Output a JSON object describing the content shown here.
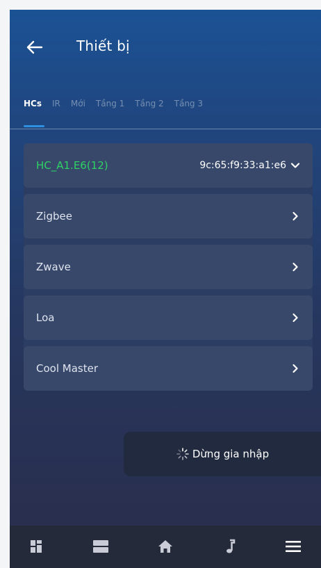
{
  "header": {
    "title": "Thiết bị",
    "back_icon": "arrow-left-icon"
  },
  "tabs": [
    {
      "label": "HCs",
      "active": true
    },
    {
      "label": "IR",
      "active": false
    },
    {
      "label": "Mới",
      "active": false
    },
    {
      "label": "Tầng 1",
      "active": false
    },
    {
      "label": "Tầng 2",
      "active": false
    },
    {
      "label": "Tầng 3",
      "active": false
    }
  ],
  "hc": {
    "name": "HC_A1.E6(12)",
    "mac": "9c:65:f9:33:a1:e6",
    "name_color": "#2fd264"
  },
  "items": [
    {
      "label": "Zigbee"
    },
    {
      "label": "Zwave"
    },
    {
      "label": "Loa"
    },
    {
      "label": "Cool Master"
    }
  ],
  "join_button": {
    "label": "Dừng gia nhập",
    "icon": "spinner-icon"
  },
  "bottom_nav": [
    {
      "name": "dashboard-icon"
    },
    {
      "name": "rooms-icon"
    },
    {
      "name": "home-icon"
    },
    {
      "name": "music-icon"
    },
    {
      "name": "menu-icon"
    }
  ],
  "colors": {
    "accent": "#2f8fe0",
    "panel": "#2b3d62",
    "row": "#37486b",
    "nav": "#252a3b"
  }
}
